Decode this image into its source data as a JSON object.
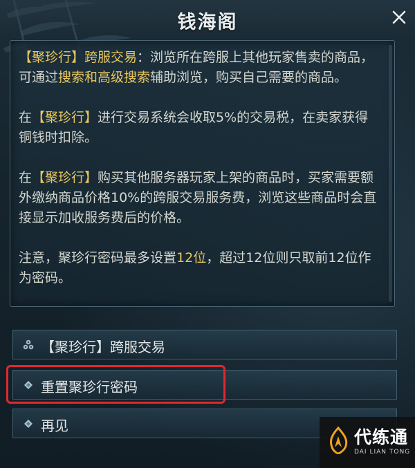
{
  "window": {
    "title": "钱海阁",
    "close_label": "×"
  },
  "description": {
    "paragraphs": [
      [
        {
          "text": "【聚珍行】跨服交易",
          "highlight": true
        },
        {
          "text": "：浏览所在跨服上其他玩家售卖的商品，可通过",
          "highlight": false
        },
        {
          "text": "搜索和高级搜索",
          "highlight": true
        },
        {
          "text": "辅助浏览，购买自己需要的商品。",
          "highlight": false
        }
      ],
      [
        {
          "text": "在",
          "highlight": false
        },
        {
          "text": "【聚珍行】",
          "highlight": true
        },
        {
          "text": "进行交易系统会收取5%的交易税，在卖家获得铜钱时扣除。",
          "highlight": false
        }
      ],
      [
        {
          "text": "在",
          "highlight": false
        },
        {
          "text": "【聚珍行】",
          "highlight": true
        },
        {
          "text": "购买其他服务器玩家上架的商品时，买家需要额外缴纳商品价格10%的跨服交易服务费，浏览这些商品时会直接显示加收服务费后的价格。",
          "highlight": false
        }
      ],
      [
        {
          "text": "注意，聚珍行密码最多设置",
          "highlight": false
        },
        {
          "text": "12位",
          "highlight": true
        },
        {
          "text": "，超过12位则只取前12位作为密码。",
          "highlight": false
        }
      ]
    ]
  },
  "options": [
    {
      "label": "【聚珍行】跨服交易",
      "icon": "coins-icon"
    },
    {
      "label": "重置聚珍行密码",
      "icon": "diamond-bullet-icon"
    },
    {
      "label": "再见",
      "icon": "diamond-bullet-icon"
    }
  ],
  "watermark": {
    "title": "代练通",
    "subtitle": "DAI LIAN TONG"
  },
  "colors": {
    "highlight_text": "#e6c55d",
    "body_text": "#d3d6cf",
    "annotation_box": "#e0282f",
    "watermark_accent": "#f0a21a"
  }
}
